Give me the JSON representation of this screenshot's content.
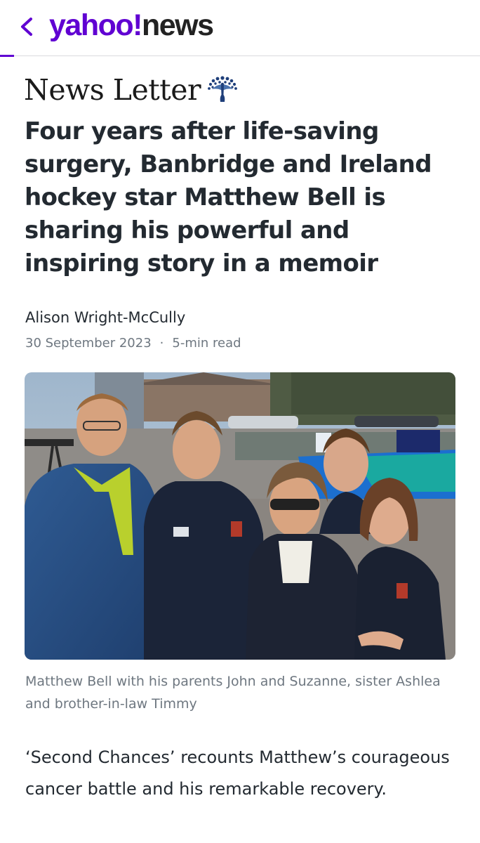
{
  "header": {
    "back_icon": "chevron-left-icon",
    "logo_yahoo": "yahoo!",
    "logo_news": "news",
    "brand_color": "#6001d2"
  },
  "publisher": {
    "name": "News Letter",
    "logo_icon": "peacock-icon"
  },
  "article": {
    "headline": "Four years after life-saving surgery, Banbridge and Ireland hockey star Matthew Bell is sharing his powerful and inspiring story in a memoir",
    "author": "Alison Wright-McCully",
    "date": "30 September 2023",
    "separator": "·",
    "read_time": "5-min read",
    "image_caption": "Matthew Bell with his parents John and Suzanne, sister Ashlea and brother-in-law Timmy",
    "lead": "‘Second Chances’ recounts Matthew’s courageous cancer battle and his remarkable recovery."
  }
}
